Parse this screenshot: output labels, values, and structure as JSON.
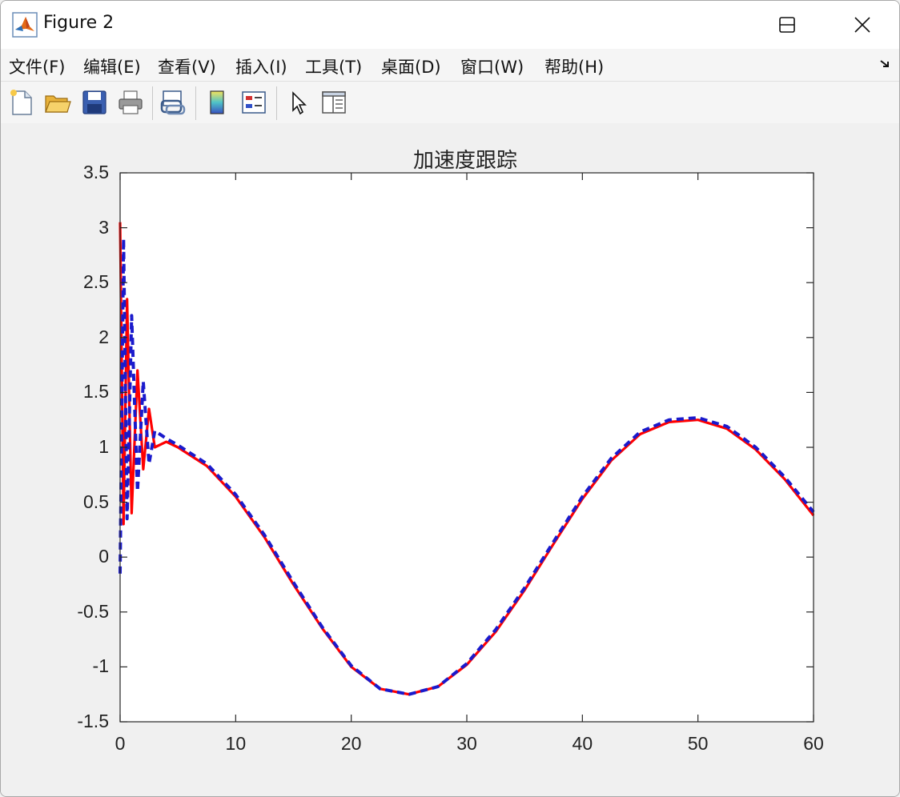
{
  "window": {
    "title": "Figure 2",
    "minimize_icon": "minimize-icon",
    "maximize_icon": "maximize-icon",
    "close_icon": "close-icon"
  },
  "menu": {
    "items": [
      {
        "label": "文件(F)"
      },
      {
        "label": "编辑(E)"
      },
      {
        "label": "查看(V)"
      },
      {
        "label": "插入(I)"
      },
      {
        "label": "工具(T)"
      },
      {
        "label": "桌面(D)"
      },
      {
        "label": "窗口(W)"
      },
      {
        "label": "帮助(H)"
      }
    ]
  },
  "toolbar": {
    "tools": [
      {
        "icon": "new-figure-icon"
      },
      {
        "icon": "open-file-icon"
      },
      {
        "icon": "save-icon"
      },
      {
        "icon": "print-icon"
      },
      {
        "icon": "link-plot-icon"
      },
      {
        "icon": "insert-colorbar-icon"
      },
      {
        "icon": "insert-legend-icon"
      },
      {
        "icon": "edit-plot-icon"
      },
      {
        "icon": "property-inspector-icon"
      }
    ]
  },
  "chart_data": {
    "type": "line",
    "title": "加速度跟踪",
    "xlabel": "",
    "ylabel": "",
    "xlim": [
      0,
      60
    ],
    "ylim": [
      -1.5,
      3.5
    ],
    "xticks": [
      "0",
      "10",
      "20",
      "30",
      "40",
      "50",
      "60"
    ],
    "yticks": [
      "-1.5",
      "-1",
      "-0.5",
      "0",
      "0.5",
      "1",
      "1.5",
      "2",
      "2.5",
      "3",
      "3.5"
    ],
    "grid": false,
    "series": [
      {
        "color": "#ff0000",
        "style": "solid",
        "x": [
          0,
          0.3,
          0.6,
          1,
          1.5,
          2,
          2.5,
          3,
          4,
          5,
          7.5,
          10,
          12.5,
          15,
          17.5,
          20,
          22.5,
          25,
          27.5,
          30,
          32.5,
          35,
          37.5,
          40,
          42.5,
          45,
          47.5,
          50,
          52.5,
          55,
          57.5,
          60
        ],
        "y": [
          3.05,
          0.3,
          2.35,
          0.4,
          1.7,
          0.8,
          1.35,
          1.0,
          1.05,
          1.0,
          0.83,
          0.55,
          0.18,
          -0.25,
          -0.65,
          -1.0,
          -1.2,
          -1.25,
          -1.18,
          -0.98,
          -0.68,
          -0.3,
          0.12,
          0.53,
          0.88,
          1.12,
          1.23,
          1.25,
          1.17,
          0.98,
          0.71,
          0.38
        ]
      },
      {
        "color": "#1a1acc",
        "style": "dashed",
        "x": [
          0,
          0.3,
          0.6,
          1,
          1.5,
          2,
          2.5,
          3,
          4,
          5,
          7.5,
          10,
          12.5,
          15,
          17.5,
          20,
          22.5,
          25,
          27.5,
          30,
          32.5,
          35,
          37.5,
          40,
          42.5,
          45,
          47.5,
          50,
          52.5,
          55,
          57.5,
          60
        ],
        "y": [
          -0.15,
          2.9,
          0.35,
          2.2,
          0.6,
          1.6,
          0.85,
          1.15,
          1.08,
          1.02,
          0.85,
          0.57,
          0.2,
          -0.23,
          -0.64,
          -0.99,
          -1.2,
          -1.25,
          -1.18,
          -0.97,
          -0.66,
          -0.28,
          0.14,
          0.55,
          0.9,
          1.14,
          1.25,
          1.27,
          1.19,
          1.0,
          0.73,
          0.41
        ]
      }
    ]
  }
}
